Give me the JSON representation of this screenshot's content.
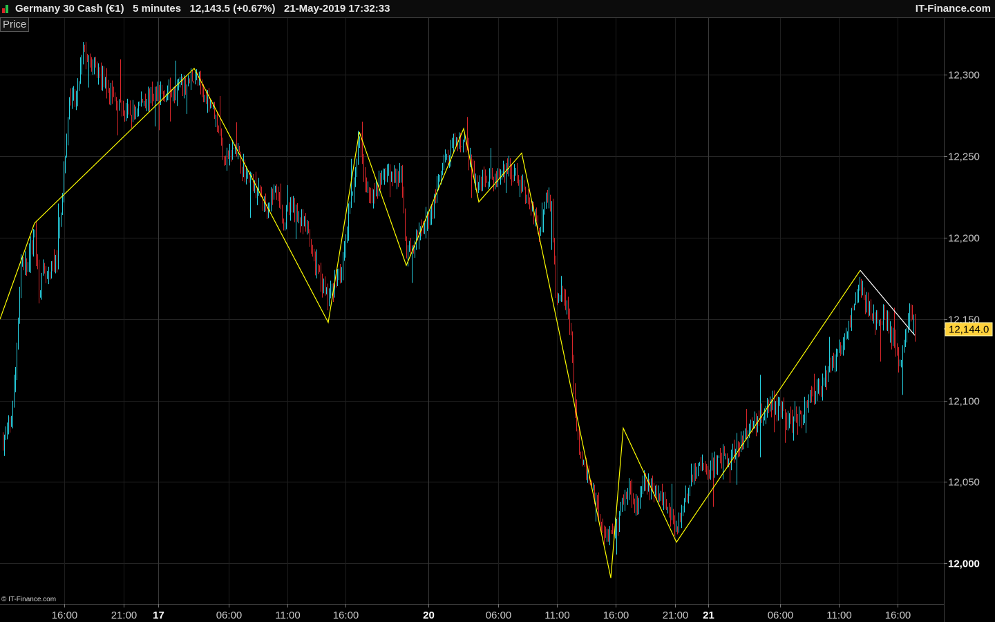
{
  "header": {
    "instrument": "Germany 30 Cash (€1)",
    "interval": "5 minutes",
    "quote": "12,143.5 (+0.67%)",
    "datetime": "21-May-2019 17:32:33",
    "brand": "IT-Finance.com"
  },
  "panel_label": "Price",
  "copyright": "© IT-Finance.com",
  "colors": {
    "up": "#26d0e0",
    "down": "#d8262a",
    "zigzag": "#ffff00",
    "zigzag_last": "#ffffff",
    "price_badge": "#ffd23c"
  },
  "chart_data": {
    "type": "candlestick",
    "ylim": [
      11975,
      12335
    ],
    "xlim": [
      0,
      1366
    ],
    "y_ticks": [
      {
        "value": 12300,
        "label": "12,300"
      },
      {
        "value": 12250,
        "label": "12,250"
      },
      {
        "value": 12200,
        "label": "12,200"
      },
      {
        "value": 12150,
        "label": "12,150"
      },
      {
        "value": 12100,
        "label": "12,100"
      },
      {
        "value": 12050,
        "label": "12,050"
      },
      {
        "value": 12000,
        "label": "12,000"
      }
    ],
    "x_ticks": [
      {
        "pos": 93,
        "label": "16:00"
      },
      {
        "pos": 179,
        "label": "21:00"
      },
      {
        "pos": 229,
        "label": "17",
        "bold": true
      },
      {
        "pos": 331,
        "label": "06:00"
      },
      {
        "pos": 416,
        "label": "11:00"
      },
      {
        "pos": 500,
        "label": "16:00"
      },
      {
        "pos": 620,
        "label": "20",
        "bold": true
      },
      {
        "pos": 721,
        "label": "06:00"
      },
      {
        "pos": 806,
        "label": "11:00"
      },
      {
        "pos": 891,
        "label": "16:00"
      },
      {
        "pos": 977,
        "label": "21:00"
      },
      {
        "pos": 1025,
        "label": "21",
        "bold": true
      },
      {
        "pos": 1129,
        "label": "06:00"
      },
      {
        "pos": 1214,
        "label": "11:00"
      },
      {
        "pos": 1299,
        "label": "16:00"
      }
    ],
    "last_price": {
      "value": 12144.0,
      "label": "12,144.0"
    },
    "zigzag": [
      {
        "x": 0,
        "y": 12150
      },
      {
        "x": 50,
        "y": 12209
      },
      {
        "x": 281,
        "y": 12304
      },
      {
        "x": 475,
        "y": 12148
      },
      {
        "x": 520,
        "y": 12265
      },
      {
        "x": 588,
        "y": 12183
      },
      {
        "x": 671,
        "y": 12267
      },
      {
        "x": 693,
        "y": 12222
      },
      {
        "x": 755,
        "y": 12252
      },
      {
        "x": 884,
        "y": 11991
      },
      {
        "x": 902,
        "y": 12083
      },
      {
        "x": 979,
        "y": 12013
      },
      {
        "x": 1245,
        "y": 12180
      }
    ],
    "zigzag_last": [
      {
        "x": 1245,
        "y": 12180
      },
      {
        "x": 1324,
        "y": 12140
      }
    ],
    "price_path": [
      [
        4,
        12075
      ],
      [
        15,
        12085
      ],
      [
        22,
        12118
      ],
      [
        30,
        12185
      ],
      [
        40,
        12183
      ],
      [
        50,
        12205
      ],
      [
        56,
        12168
      ],
      [
        62,
        12178
      ],
      [
        70,
        12174
      ],
      [
        82,
        12188
      ],
      [
        92,
        12240
      ],
      [
        100,
        12283
      ],
      [
        110,
        12285
      ],
      [
        120,
        12315
      ],
      [
        132,
        12305
      ],
      [
        145,
        12300
      ],
      [
        160,
        12288
      ],
      [
        175,
        12280
      ],
      [
        190,
        12275
      ],
      [
        205,
        12284
      ],
      [
        220,
        12287
      ],
      [
        240,
        12290
      ],
      [
        255,
        12292
      ],
      [
        270,
        12293
      ],
      [
        281,
        12300
      ],
      [
        295,
        12287
      ],
      [
        305,
        12285
      ],
      [
        315,
        12268
      ],
      [
        325,
        12248
      ],
      [
        340,
        12255
      ],
      [
        355,
        12240
      ],
      [
        370,
        12230
      ],
      [
        385,
        12220
      ],
      [
        400,
        12230
      ],
      [
        410,
        12210
      ],
      [
        425,
        12220
      ],
      [
        435,
        12208
      ],
      [
        445,
        12205
      ],
      [
        455,
        12185
      ],
      [
        465,
        12172
      ],
      [
        475,
        12162
      ],
      [
        485,
        12175
      ],
      [
        495,
        12182
      ],
      [
        505,
        12215
      ],
      [
        515,
        12245
      ],
      [
        520,
        12262
      ],
      [
        528,
        12235
      ],
      [
        540,
        12225
      ],
      [
        550,
        12238
      ],
      [
        560,
        12240
      ],
      [
        570,
        12238
      ],
      [
        580,
        12236
      ],
      [
        588,
        12190
      ],
      [
        600,
        12195
      ],
      [
        612,
        12205
      ],
      [
        625,
        12218
      ],
      [
        640,
        12242
      ],
      [
        655,
        12255
      ],
      [
        671,
        12260
      ],
      [
        680,
        12245
      ],
      [
        690,
        12232
      ],
      [
        700,
        12238
      ],
      [
        715,
        12235
      ],
      [
        730,
        12242
      ],
      [
        745,
        12238
      ],
      [
        758,
        12232
      ],
      [
        770,
        12215
      ],
      [
        780,
        12205
      ],
      [
        790,
        12225
      ],
      [
        798,
        12218
      ],
      [
        805,
        12160
      ],
      [
        815,
        12165
      ],
      [
        825,
        12145
      ],
      [
        833,
        12085
      ],
      [
        842,
        12060
      ],
      [
        852,
        12052
      ],
      [
        862,
        12040
      ],
      [
        872,
        12020
      ],
      [
        884,
        12018
      ],
      [
        893,
        12022
      ],
      [
        902,
        12040
      ],
      [
        912,
        12045
      ],
      [
        922,
        12035
      ],
      [
        932,
        12050
      ],
      [
        945,
        12045
      ],
      [
        958,
        12040
      ],
      [
        970,
        12030
      ],
      [
        979,
        12020
      ],
      [
        990,
        12040
      ],
      [
        1000,
        12052
      ],
      [
        1010,
        12060
      ],
      [
        1025,
        12057
      ],
      [
        1040,
        12062
      ],
      [
        1055,
        12065
      ],
      [
        1070,
        12072
      ],
      [
        1085,
        12083
      ],
      [
        1100,
        12090
      ],
      [
        1115,
        12098
      ],
      [
        1130,
        12095
      ],
      [
        1145,
        12085
      ],
      [
        1160,
        12092
      ],
      [
        1175,
        12105
      ],
      [
        1190,
        12110
      ],
      [
        1205,
        12125
      ],
      [
        1215,
        12130
      ],
      [
        1225,
        12140
      ],
      [
        1235,
        12160
      ],
      [
        1245,
        12170
      ],
      [
        1255,
        12158
      ],
      [
        1265,
        12150
      ],
      [
        1275,
        12152
      ],
      [
        1285,
        12145
      ],
      [
        1295,
        12132
      ],
      [
        1302,
        12122
      ],
      [
        1310,
        12138
      ],
      [
        1316,
        12155
      ],
      [
        1324,
        12144
      ]
    ]
  }
}
